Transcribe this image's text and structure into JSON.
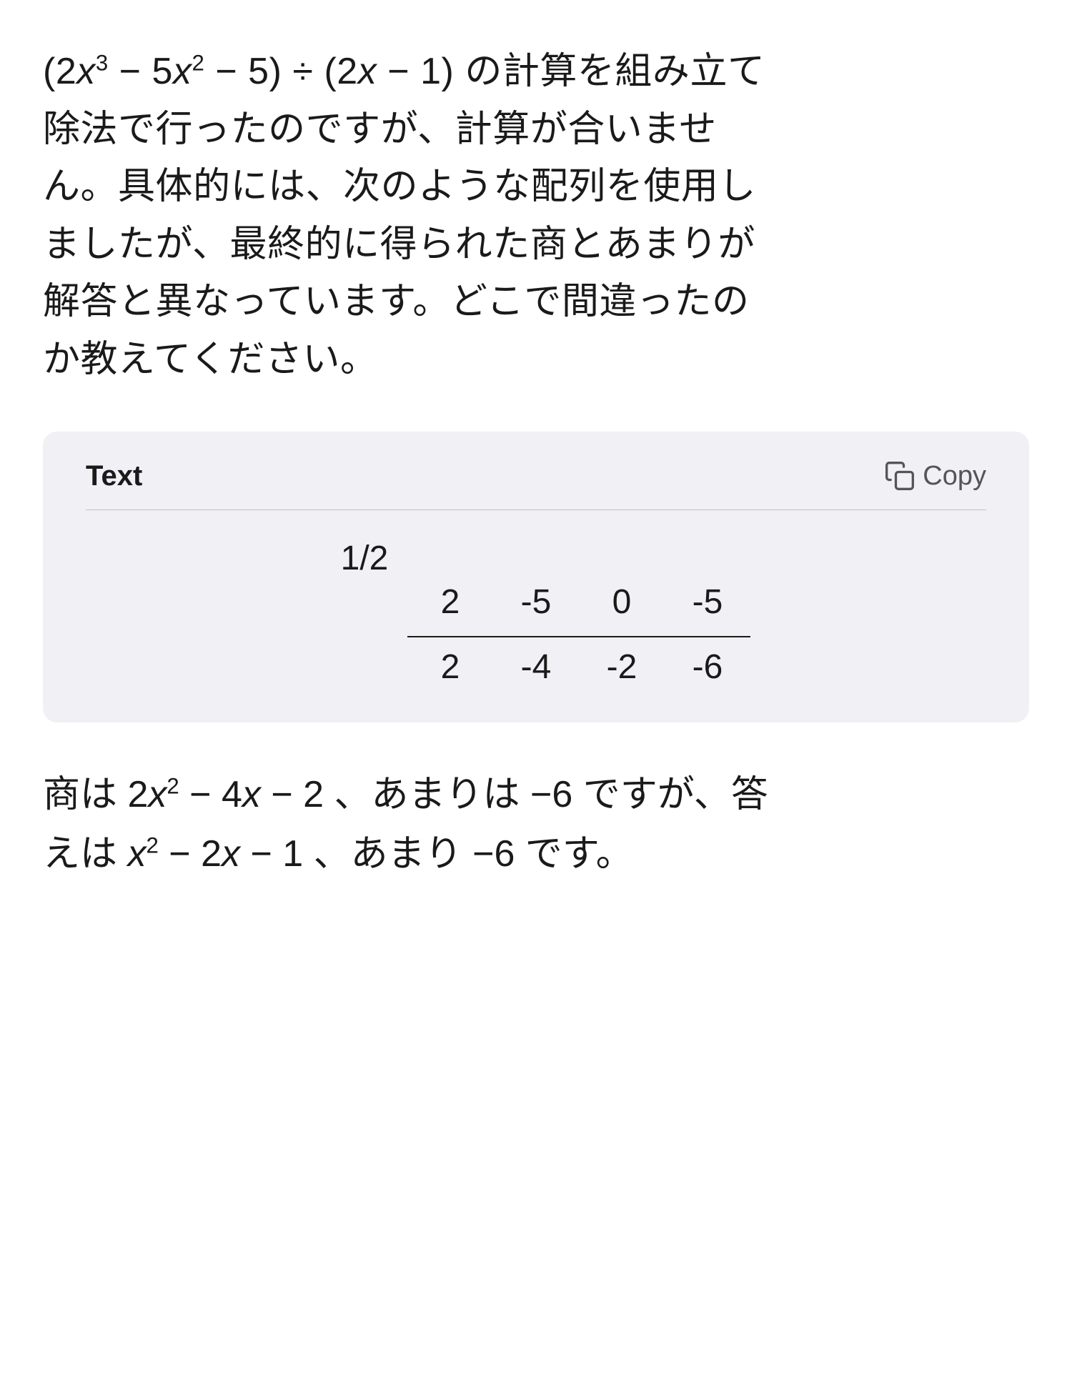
{
  "question": {
    "text_raw": "(2x³ − 5x² − 5) ÷ (2x − 1) の計算を組み立て除法で行ったのですが、計算が合いません。具体的には、次のような配列を使用しましたが、最終的に得られた商とあまりが解答と異なっています。どこで間違ったのか教えてください。"
  },
  "code_box": {
    "label": "Text",
    "copy_label": "Copy",
    "divisor": "1/2",
    "coefficients": [
      "2",
      "-5",
      "0",
      "-5"
    ],
    "results": [
      "2",
      "-4",
      "-2",
      "-6"
    ]
  },
  "answer": {
    "part1": "商は 2x² − 4x − 2 、あまりは −6 ですが、答えは x² − 2x − 1 、あまり −6 です。"
  }
}
